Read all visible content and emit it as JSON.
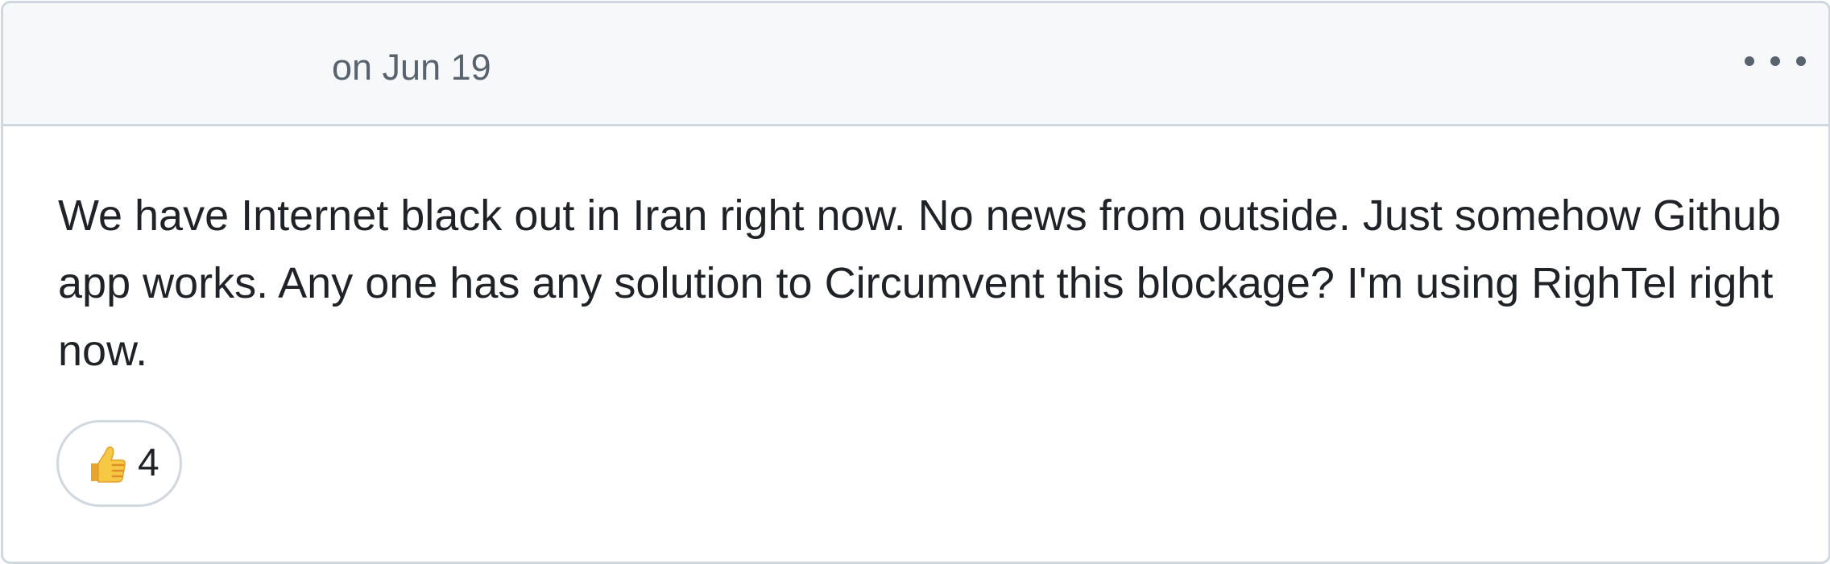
{
  "comment": {
    "timestamp": "on Jun 19",
    "body": "We have Internet black out in Iran right now. No news from outside. Just somehow Github app works. Any one has any solution to Circumvent this blockage? I'm using RighTel right now.",
    "reactions": [
      {
        "icon": "thumbs-up-icon",
        "count": "4"
      }
    ]
  },
  "colors": {
    "header_bg": "#f6f8fa",
    "border": "#d0d7de",
    "muted_text": "#59636e",
    "body_text": "#1f2328",
    "emoji_yellow": "#f7c844"
  }
}
